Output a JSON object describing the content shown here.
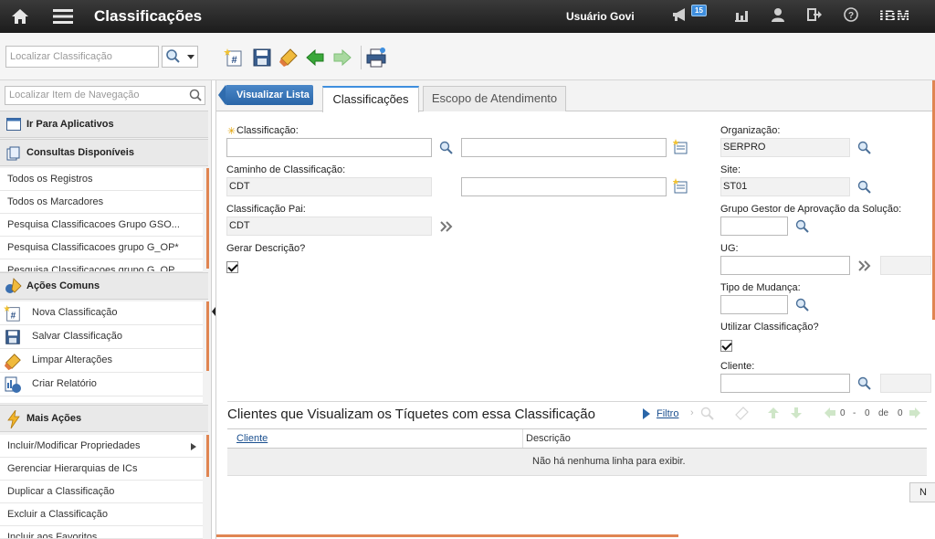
{
  "app": {
    "title": "Classificações",
    "user": "Usuário Govi",
    "notifications_count": "15",
    "brand": "IBM"
  },
  "toolbar": {
    "search_placeholder": "Localizar Classificação"
  },
  "left_panel": {
    "nav_search_placeholder": "Localizar Item de Navegação",
    "go_to_apps": "Ir Para Aplicativos",
    "available_queries": "Consultas Disponíveis",
    "queries": [
      "Todos os Registros",
      "Todos os Marcadores",
      "Pesquisa Classificacoes Grupo GSO...",
      "Pesquisa Classificacoes grupo G_OP*",
      "Pesquisa Classificacoes grupo G_OP..."
    ],
    "common_actions": "Ações Comuns",
    "actions": [
      "Nova Classificação",
      "Salvar Classificação",
      "Limpar Alterações",
      "Criar Relatório"
    ],
    "more_actions": "Mais Ações",
    "more": [
      "Incluir/Modificar Propriedades",
      "Gerenciar Hierarquias de ICs",
      "Duplicar a Classificação",
      "Excluir a Classificação",
      "Incluir aos Favoritos"
    ]
  },
  "main": {
    "back_button": "Visualizar Lista",
    "tabs": [
      "Classificações",
      "Escopo de Atendimento"
    ],
    "form": {
      "classificacao_label": "Classificação:",
      "classificacao_value": "",
      "classificacao_desc": "",
      "caminho_label": "Caminho de Classificação:",
      "caminho_value": "CDT",
      "caminho_desc": "",
      "pai_label": "Classificação Pai:",
      "pai_value": "CDT",
      "gerar_label": "Gerar Descrição?",
      "gerar_checked": true,
      "org_label": "Organização:",
      "org_value": "SERPRO",
      "site_label": "Site:",
      "site_value": "ST01",
      "grupo_label": "Grupo Gestor de Aprovação da Solução:",
      "grupo_value": "",
      "ug_label": "UG:",
      "ug_value": "",
      "tipo_label": "Tipo de Mudança:",
      "tipo_value": "",
      "utilizar_label": "Utilizar Classificação?",
      "utilizar_checked": true,
      "cliente_label": "Cliente:",
      "cliente_value": ""
    },
    "clients_section": {
      "title": "Clientes que Visualizam os Tíquetes com essa Classificação",
      "filter": "Filtro",
      "pager_from": "0",
      "pager_to": "0",
      "pager_of": "de",
      "pager_total": "0",
      "pager_dash": "-",
      "col_cliente": "Cliente",
      "col_descricao": "Descrição",
      "empty_message": "Não há nenhuma linha para exibir.",
      "new_row_button": "N"
    }
  },
  "colors": {
    "accent": "#3e8ede",
    "scroll_accent": "#e08552",
    "topbar": "#2a2a2a"
  }
}
